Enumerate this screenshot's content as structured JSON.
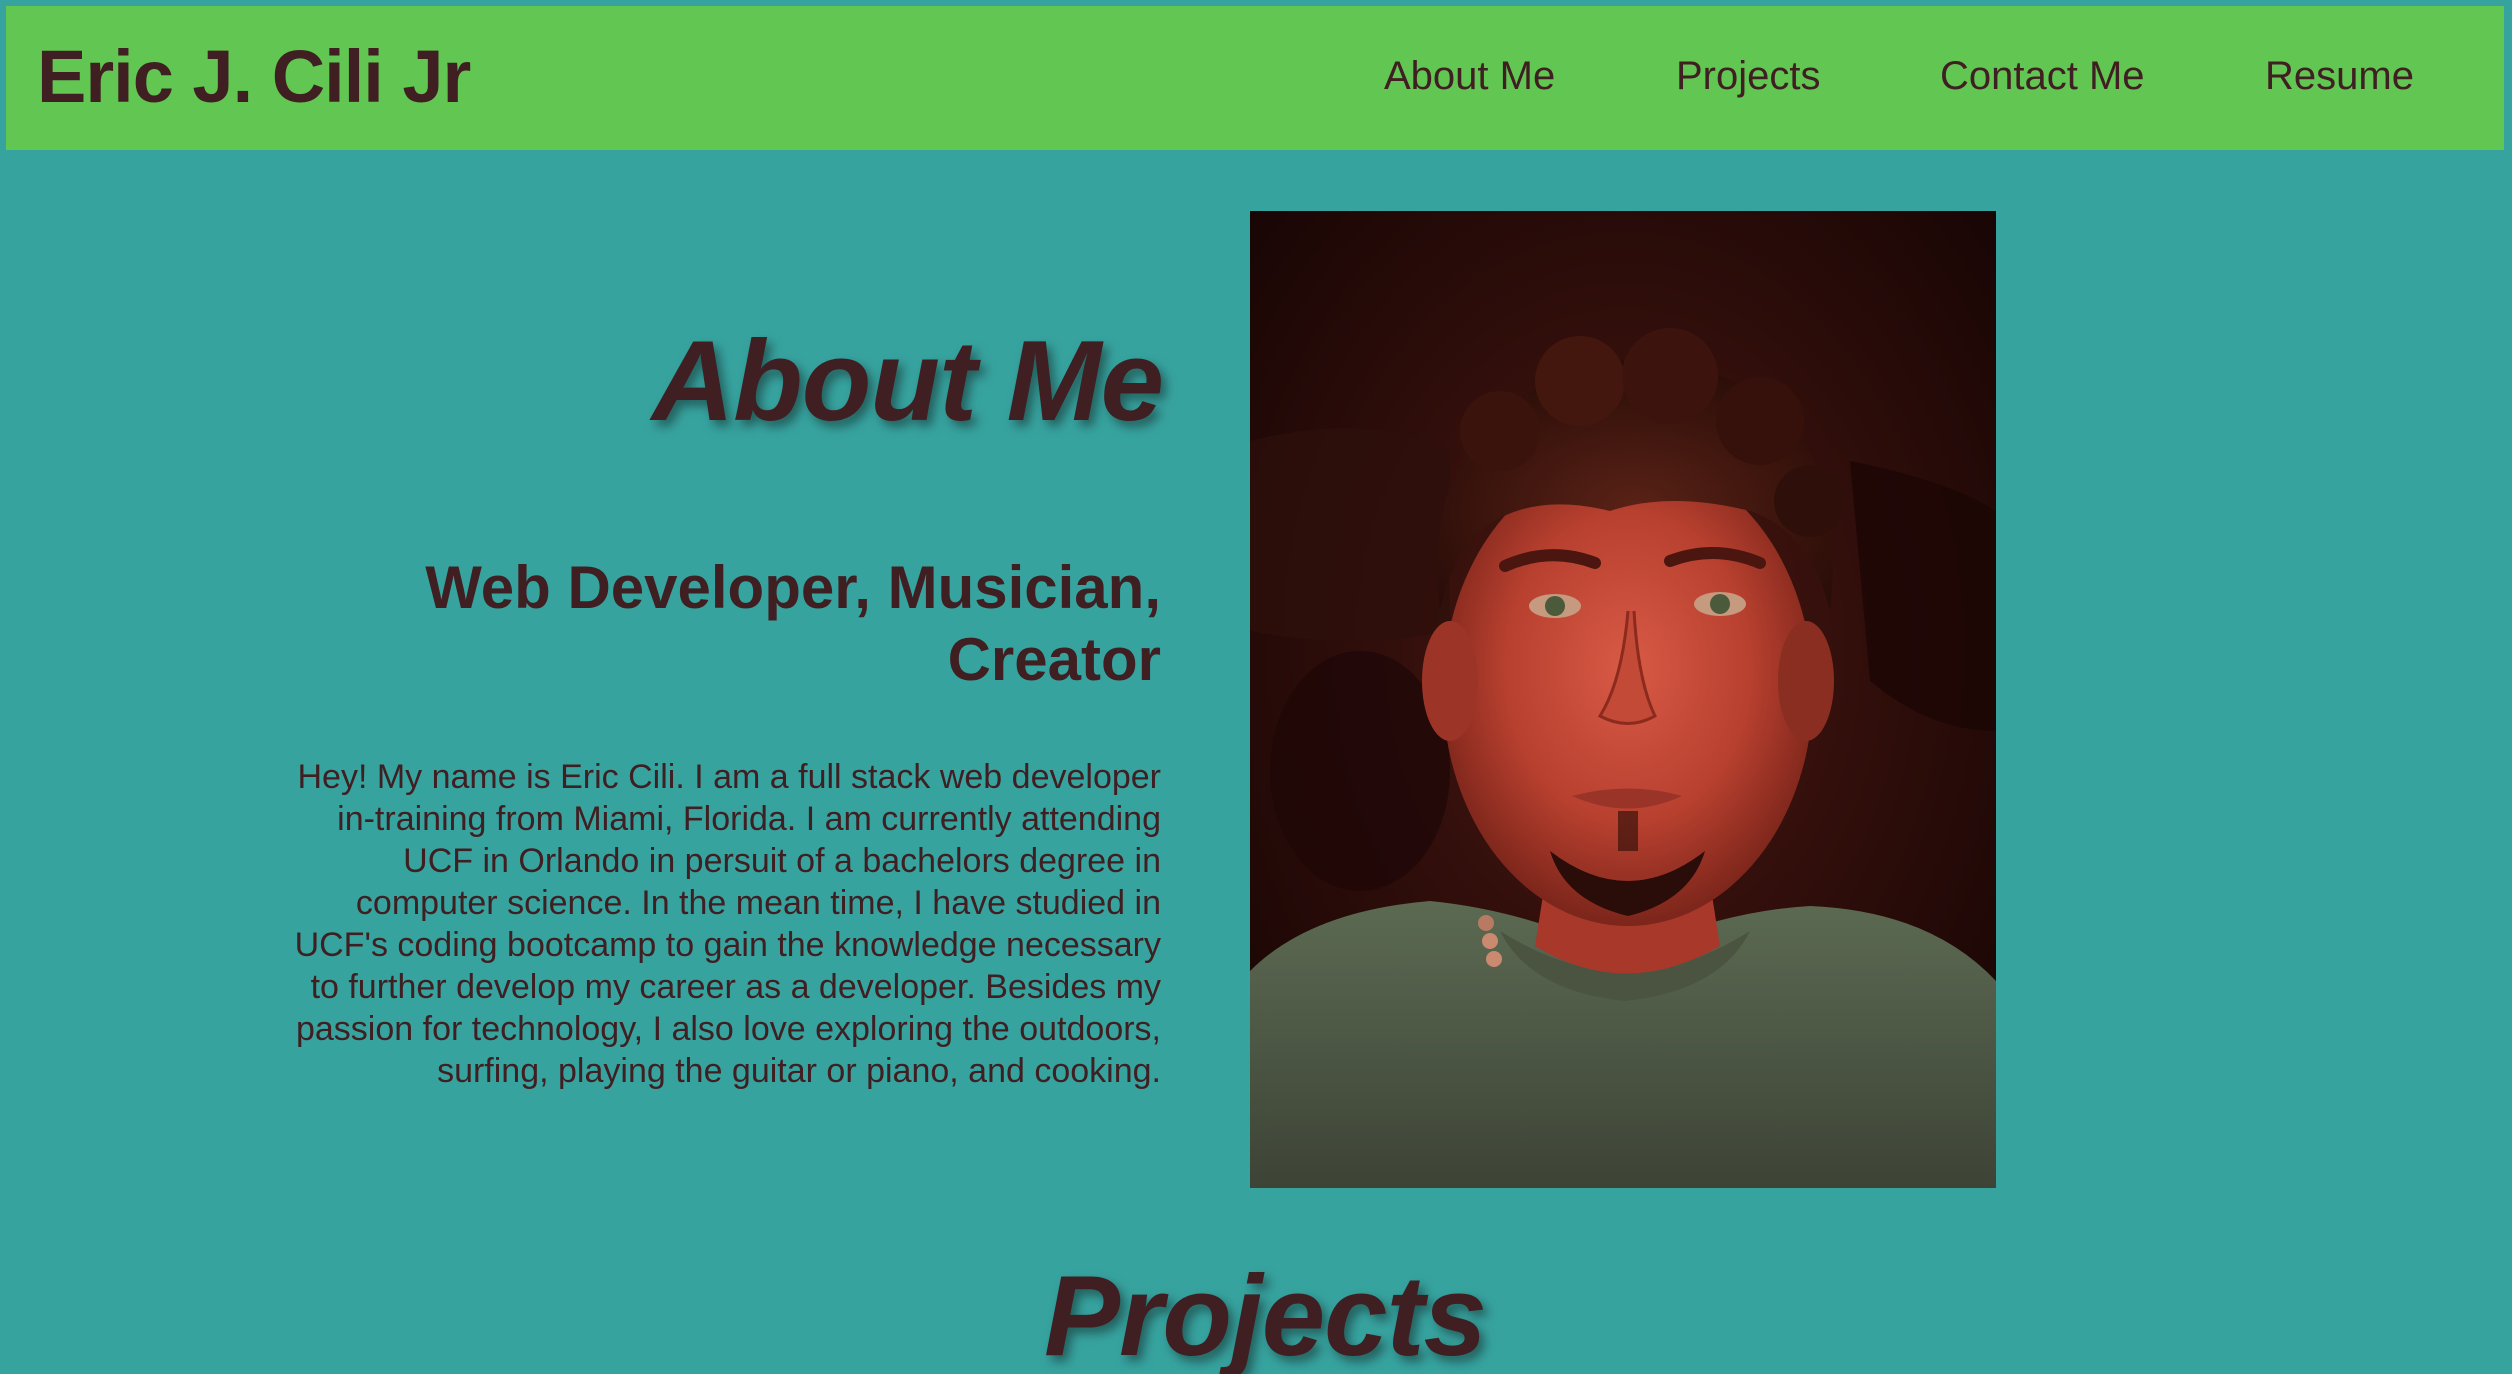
{
  "header": {
    "site_title": "Eric J. Cili Jr",
    "nav": {
      "about": "About Me",
      "projects": "Projects",
      "contact": "Contact Me",
      "resume": "Resume"
    }
  },
  "about": {
    "heading": "About Me",
    "subtitle": "Web Developer, Musician, Creator",
    "body": "Hey! My name is Eric Cili. I am a full stack web developer in-training from Miami, Florida. I am currently attending UCF in Orlando in persuit of a bachelors degree in computer science. In the mean time, I have studied in UCF's coding bootcamp to gain the knowledge necessary to further develop my career as a developer. Besides my passion for technology, I also love exploring the outdoors, surfing, playing the guitar or piano, and cooking."
  },
  "projects": {
    "heading": "Projects"
  },
  "colors": {
    "page_background": "#37a39f",
    "navbar_background": "#62c652",
    "text": "#3f1f22"
  }
}
